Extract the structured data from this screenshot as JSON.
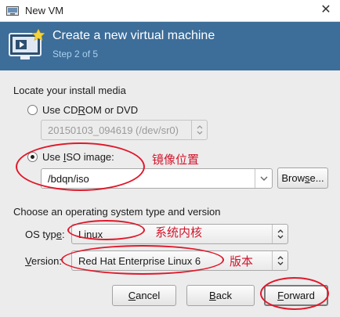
{
  "window": {
    "title": "New VM",
    "close_glyph": "✕"
  },
  "banner": {
    "heading": "Create a new virtual machine",
    "step": "Step 2 of 5"
  },
  "install_media": {
    "section_label": "Locate your install media",
    "cdrom": {
      "label_pre": "Use CD",
      "label_u": "R",
      "label_post": "OM or DVD",
      "selected": false,
      "device": "20150103_094619 (/dev/sr0)"
    },
    "iso": {
      "label_pre": "Use ",
      "label_u": "I",
      "label_post": "SO image:",
      "selected": true,
      "path": "/bdqn/iso"
    },
    "browse": {
      "pre": "Brow",
      "u": "s",
      "post": "e..."
    }
  },
  "os": {
    "section_label": "Choose an operating system type and version",
    "type_label": {
      "pre": "OS typ",
      "u": "e",
      "post": ":"
    },
    "type_value": "Linux",
    "version_label": {
      "u": "V",
      "post": "ersion:"
    },
    "version_value": "Red Hat Enterprise Linux 6"
  },
  "annotations": {
    "iso": "镜像位置",
    "os_type": "系统内核",
    "version": "版本"
  },
  "buttons": {
    "cancel": {
      "u": "C",
      "post": "ancel"
    },
    "back": {
      "u": "B",
      "post": "ack"
    },
    "forward": {
      "u": "F",
      "post": "orward"
    }
  },
  "colors": {
    "banner": "#3d6d99",
    "annotation": "#e0182a"
  },
  "icons": {
    "app": "vm-manager-icon",
    "banner": "new-vm-monitor-icon"
  }
}
